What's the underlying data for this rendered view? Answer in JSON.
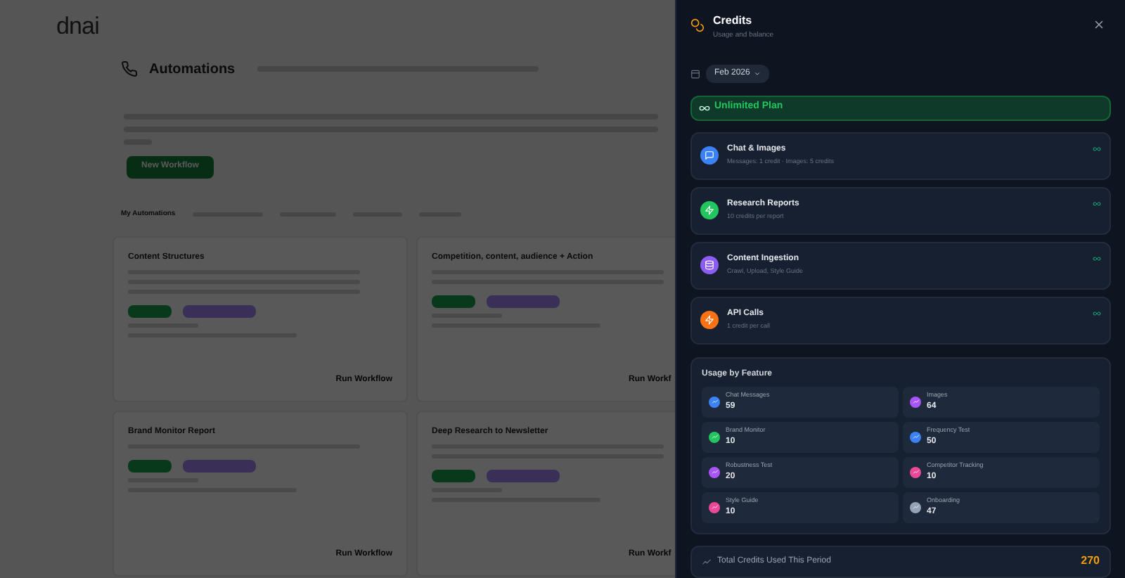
{
  "background_page": {
    "logo": "dnai",
    "header": {
      "title": "Automations"
    },
    "new_button": "New Workflow",
    "tabs": [
      {
        "label": "My Automations",
        "selected": true
      }
    ],
    "cards": [
      {
        "title": "Content Structures",
        "run": "Run Workflow"
      },
      {
        "title": "Competition, content, audience + Action",
        "run": "Run Workf"
      },
      {
        "title": "Brand Monitor Report",
        "run": "Run Workflow"
      },
      {
        "title": "Deep Research to Newsletter",
        "run": "Run Workf"
      }
    ]
  },
  "drawer": {
    "title": "Credits",
    "subtitle": "Usage and balance",
    "period": "Feb 2026",
    "plan": "Unlimited Plan",
    "costs": [
      {
        "name": "Chat & Images",
        "detail": "Messages: 1 credit · Images: 5 credits",
        "color": "#3b82f6"
      },
      {
        "name": "Research Reports",
        "detail": "10 credits per report",
        "color": "#22c55e"
      },
      {
        "name": "Content Ingestion",
        "detail": "Crawl, Upload, Style Guide",
        "color": "#8b5cf6"
      },
      {
        "name": "API Calls",
        "detail": "1 credit per call",
        "color": "#f97316"
      }
    ],
    "usage_title": "Usage by Feature",
    "usage": [
      {
        "name": "Chat Messages",
        "value": "59",
        "color": "#3b82f6"
      },
      {
        "name": "Images",
        "value": "64",
        "color": "#a855f7"
      },
      {
        "name": "Brand Monitor",
        "value": "10",
        "color": "#22c55e"
      },
      {
        "name": "Frequency Test",
        "value": "50",
        "color": "#3b82f6"
      },
      {
        "name": "Robustness Test",
        "value": "20",
        "color": "#a855f7"
      },
      {
        "name": "Competitor Tracking",
        "value": "10",
        "color": "#ec4899"
      },
      {
        "name": "Style Guide",
        "value": "10",
        "color": "#ec4899"
      },
      {
        "name": "Onboarding",
        "value": "47",
        "color": "#94a3b8"
      }
    ],
    "total_label": "Total Credits Used This Period",
    "total": "270"
  }
}
